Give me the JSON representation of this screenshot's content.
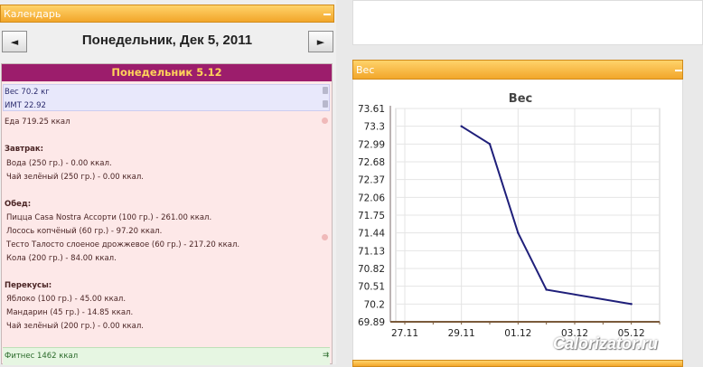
{
  "calendar": {
    "header": "Календарь",
    "prev_icon": "◄",
    "next_icon": "►",
    "date_title": "Понедельник, Дек 5, 2011",
    "day_header": "Понедельник 5.12",
    "weight": "Вес 70.2 кг",
    "bmi": "ИМТ 22.92",
    "food_total": "Еда 719.25 ккал",
    "breakfast": {
      "title": "Завтрак:",
      "items": [
        "Вода (250 гр.) - 0.00 ккал.",
        "Чай зелёный (250 гр.) - 0.00 ккал."
      ]
    },
    "lunch": {
      "title": "Обед:",
      "items": [
        "Пицца Casa Nostra Ассорти (100 гр.) - 261.00 ккал.",
        "Лосось копчёный (60 гр.) - 97.20 ккал.",
        "Тесто Талосто слоеное дрожжевое (60 гр.) - 217.20 ккал.",
        "Кола (200 гр.) - 84.00 ккал."
      ]
    },
    "snacks": {
      "title": "Перекусы:",
      "items": [
        "Яблоко (100 гр.) - 45.00 ккал.",
        "Мандарин (45 гр.) - 14.85 ккал.",
        "Чай зелёный (200 гр.) - 0.00 ккал."
      ]
    },
    "fitness": "Фитнес 1462 ккал"
  },
  "weight_panel": {
    "header": "Вес"
  },
  "watermark": "Calorizator.ru",
  "colors": {
    "orange": "#f2a62a",
    "day_header_bg": "#9c1d6c",
    "day_header_text": "#ffd35a",
    "line": "#1f1f7a"
  },
  "chart_data": {
    "type": "line",
    "title": "Вес",
    "xlabel": "",
    "ylabel": "",
    "x_tick_labels": [
      "27.11",
      "29.11",
      "01.12",
      "03.12",
      "05.12"
    ],
    "x_ticks_days": [
      0,
      2,
      4,
      6,
      8
    ],
    "y_tick_labels": [
      "73.61",
      "73.3",
      "72.99",
      "72.68",
      "72.37",
      "72.06",
      "71.75",
      "71.44",
      "71.13",
      "70.82",
      "70.51",
      "70.2",
      "69.89"
    ],
    "ylim": [
      69.89,
      73.61
    ],
    "grid": true,
    "series": [
      {
        "x": [
          "29.11",
          "30.11",
          "01.12",
          "02.12",
          "05.12"
        ],
        "x_days": [
          2,
          3,
          4,
          5,
          8
        ],
        "values": [
          73.3,
          72.99,
          71.44,
          70.45,
          70.2
        ]
      }
    ]
  }
}
